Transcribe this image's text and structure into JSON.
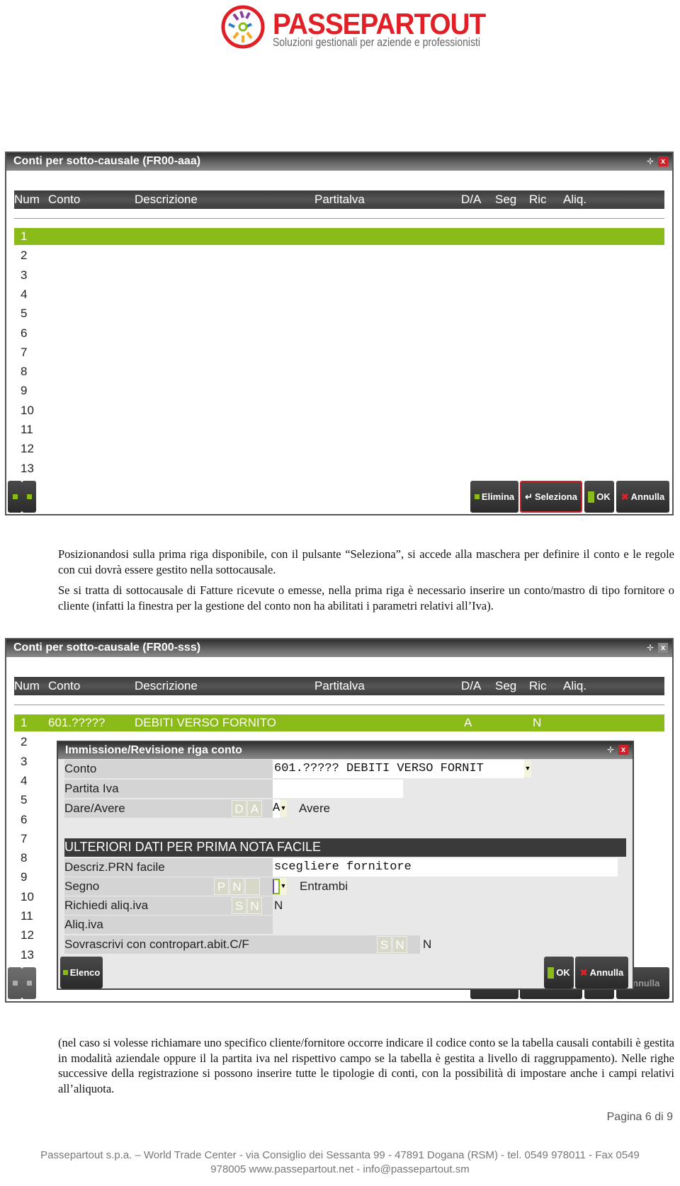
{
  "logo": {
    "name": "PASSEPARTOUT",
    "registered": "®",
    "tagline": "Soluzioni gestionali per aziende e professionisti",
    "brand_color": "#e02026"
  },
  "window1": {
    "title": "Conti per sotto-causale (FR00-aaa)",
    "columns": [
      "Num",
      "Conto",
      "Descrizione",
      "Partitalva",
      "D/A",
      "Seg",
      "Ric",
      "Aliq."
    ],
    "row_numbers": [
      "1",
      "2",
      "3",
      "4",
      "5",
      "6",
      "7",
      "8",
      "9",
      "10",
      "11",
      "12",
      "13"
    ],
    "buttons": {
      "elimina": "Elimina",
      "seleziona": "Seleziona",
      "ok": "OK",
      "annulla": "Annulla"
    }
  },
  "paragraph1": [
    "Posizionandosi sulla prima riga disponibile, con il pulsante “Seleziona”, si accede alla maschera per definire il conto e le regole con cui dovrà essere gestito nella sottocausale.",
    "Se si tratta di sottocausale di Fatture ricevute o emesse, nella prima riga è necessario inserire un conto/mastro di tipo fornitore o cliente (infatti la finestra per la gestione del conto non ha abilitati i parametri relativi all’Iva)."
  ],
  "window2": {
    "title": "Conti per sotto-causale (FR00-sss)",
    "row1": {
      "conto": "601.?????",
      "descrizione": "DEBITI VERSO FORNITO",
      "da": "A",
      "ric": "N"
    },
    "dialog": {
      "title": "Immissione/Revisione riga conto",
      "conto_label": "Conto",
      "conto_value": "601.????? DEBITI VERSO FORNIT",
      "partita_label": "Partita Iva",
      "partita_value": "",
      "dare_label": "Dare/Avere",
      "dare_keys": [
        "D",
        "A"
      ],
      "dare_value": "A",
      "dare_text": "Avere",
      "section": "ULTERIORI DATI PER PRIMA NOTA FACILE",
      "descriz_label": "Descriz.PRN facile",
      "descriz_value": "scegliere fornitore",
      "segno_label": "Segno",
      "segno_keys": [
        "P",
        "N",
        ""
      ],
      "segno_text": "Entrambi",
      "richiedi_label": "Richiedi aliq.iva",
      "richiedi_keys": [
        "S",
        "N"
      ],
      "richiedi_value": "N",
      "aliq_label": "Aliq.iva",
      "sovr_label": "Sovrascrivi con contropart.abit.C/F",
      "sovr_keys": [
        "S",
        "N"
      ],
      "sovr_value": "N",
      "elenco": "Elenco",
      "ok": "OK",
      "annulla": "Annulla"
    }
  },
  "paragraph2": "(nel caso si volesse richiamare uno specifico cliente/fornitore occorre indicare il codice conto se la tabella causali contabili è gestita in modalità aziendale oppure il la partita iva nel rispettivo campo se la tabella è gestita a livello di raggruppamento). Nelle righe successive della registrazione si possono inserire tutte le tipologie di conti, con la possibilità di impostare anche i campi relativi all’aliquota.",
  "page": "Pagina 6 di 9",
  "footer": [
    "Passepartout s.p.a. – World Trade Center - via Consiglio dei Sessanta 99 - 47891 Dogana (RSM) - tel. 0549 978011 - Fax 0549",
    "978005 www.passepartout.net - info@passepartout.sm"
  ],
  "colors": {
    "green": "#8bbb19",
    "titlebar": "#3a3a3a",
    "close": "#d0202a"
  }
}
